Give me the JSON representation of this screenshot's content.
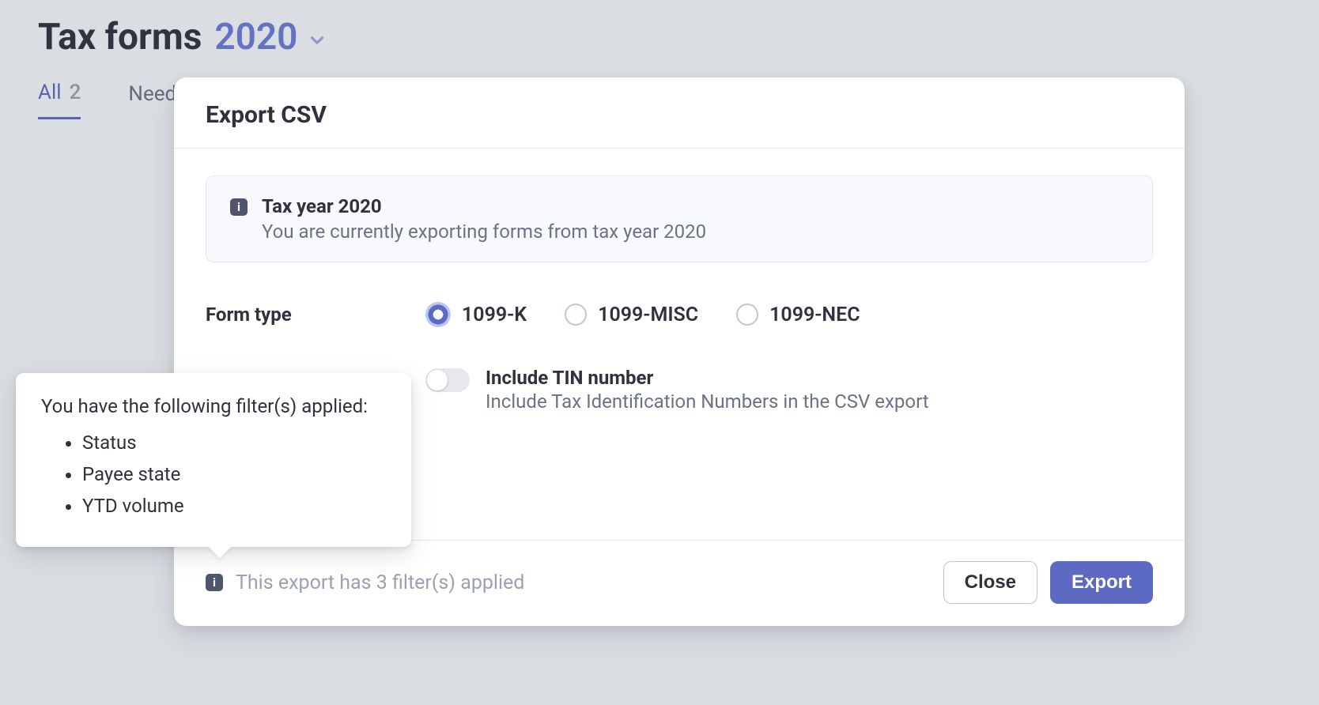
{
  "page": {
    "title": "Tax forms",
    "year": "2020"
  },
  "tabs": {
    "all_label": "All",
    "all_count": "2",
    "needs_label": "Need"
  },
  "modal": {
    "title": "Export CSV",
    "info": {
      "title": "Tax year 2020",
      "desc": "You are currently exporting forms from tax year 2020"
    },
    "form_type": {
      "label": "Form type",
      "options": {
        "k": "1099-K",
        "misc": "1099-MISC",
        "nec": "1099-NEC"
      },
      "selected": "k"
    },
    "tin": {
      "title": "Include TIN number",
      "desc": "Include Tax Identification Numbers in the CSV export"
    },
    "footer": {
      "text": "This export has 3 filter(s) applied",
      "close": "Close",
      "export": "Export"
    }
  },
  "tooltip": {
    "title": "You have the following filter(s) applied:",
    "items": {
      "0": "Status",
      "1": "Payee state",
      "2": "YTD volume"
    }
  }
}
